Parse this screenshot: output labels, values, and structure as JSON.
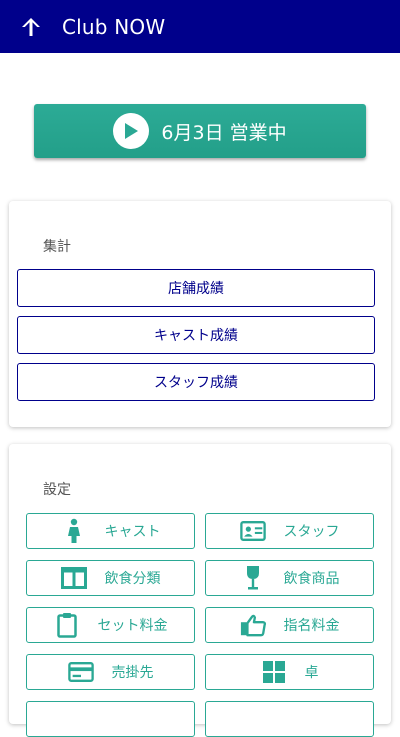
{
  "header": {
    "title": "Club NOW",
    "back_icon": "arrow-up-icon",
    "bg_color": "#00008b"
  },
  "status_button": {
    "label": "6月3日 営業中",
    "icon": "play-circle-icon",
    "color": "#2aa894"
  },
  "summary": {
    "title": "集計",
    "buttons": [
      {
        "label": "店舗成績"
      },
      {
        "label": "キャスト成績"
      },
      {
        "label": "スタッフ成績"
      }
    ]
  },
  "settings": {
    "title": "設定",
    "buttons": [
      {
        "label": "キャスト",
        "icon": "person-icon"
      },
      {
        "label": "スタッフ",
        "icon": "id-card-icon"
      },
      {
        "label": "飲食分類",
        "icon": "columns-icon"
      },
      {
        "label": "飲食商品",
        "icon": "wine-glass-icon"
      },
      {
        "label": "セット料金",
        "icon": "clipboard-icon"
      },
      {
        "label": "指名料金",
        "icon": "thumbs-up-icon"
      },
      {
        "label": "売掛先",
        "icon": "credit-card-icon"
      },
      {
        "label": "卓",
        "icon": "grid-icon"
      }
    ]
  }
}
